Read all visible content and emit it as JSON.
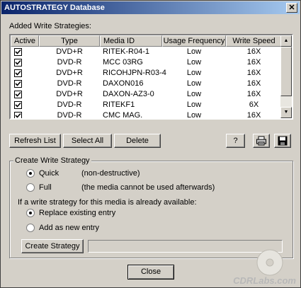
{
  "window": {
    "title": "AUTOSTRATEGY Database"
  },
  "added_label": "Added Write Strategies:",
  "columns": [
    "Active",
    "Type",
    "Media ID",
    "Usage Frequency",
    "Write Speed"
  ],
  "rows": [
    {
      "active": true,
      "type": "DVD+R",
      "media_id": "RITEK-R04-1",
      "usage": "Low",
      "speed": "16X"
    },
    {
      "active": true,
      "type": "DVD-R",
      "media_id": "MCC 03RG",
      "usage": "Low",
      "speed": "16X"
    },
    {
      "active": true,
      "type": "DVD+R",
      "media_id": "RICOHJPN-R03-4",
      "usage": "Low",
      "speed": "16X"
    },
    {
      "active": true,
      "type": "DVD-R",
      "media_id": "DAXON016",
      "usage": "Low",
      "speed": "16X"
    },
    {
      "active": true,
      "type": "DVD+R",
      "media_id": "DAXON-AZ3-0",
      "usage": "Low",
      "speed": "16X"
    },
    {
      "active": true,
      "type": "DVD-R",
      "media_id": "RITEKF1",
      "usage": "Low",
      "speed": "6X"
    },
    {
      "active": true,
      "type": "DVD-R",
      "media_id": "CMC MAG.",
      "usage": "Low",
      "speed": "16X"
    }
  ],
  "buttons": {
    "refresh": "Refresh List",
    "select_all": "Select All",
    "delete": "Delete",
    "help": "?",
    "create": "Create Strategy",
    "close": "Close"
  },
  "icons": {
    "print": "printer-icon",
    "save": "floppy-disk-icon"
  },
  "create_group": {
    "title": "Create Write Strategy",
    "quick_label": "Quick",
    "quick_desc": "(non-destructive)",
    "full_label": "Full",
    "full_desc": "(the media cannot be used afterwards)",
    "existing_prompt": "If a write strategy for this media is already available:",
    "replace_label": "Replace existing entry",
    "add_label": "Add as new entry",
    "selected_mode": "Quick",
    "selected_existing": "Replace existing entry"
  },
  "watermark": "CDRLabs.com"
}
